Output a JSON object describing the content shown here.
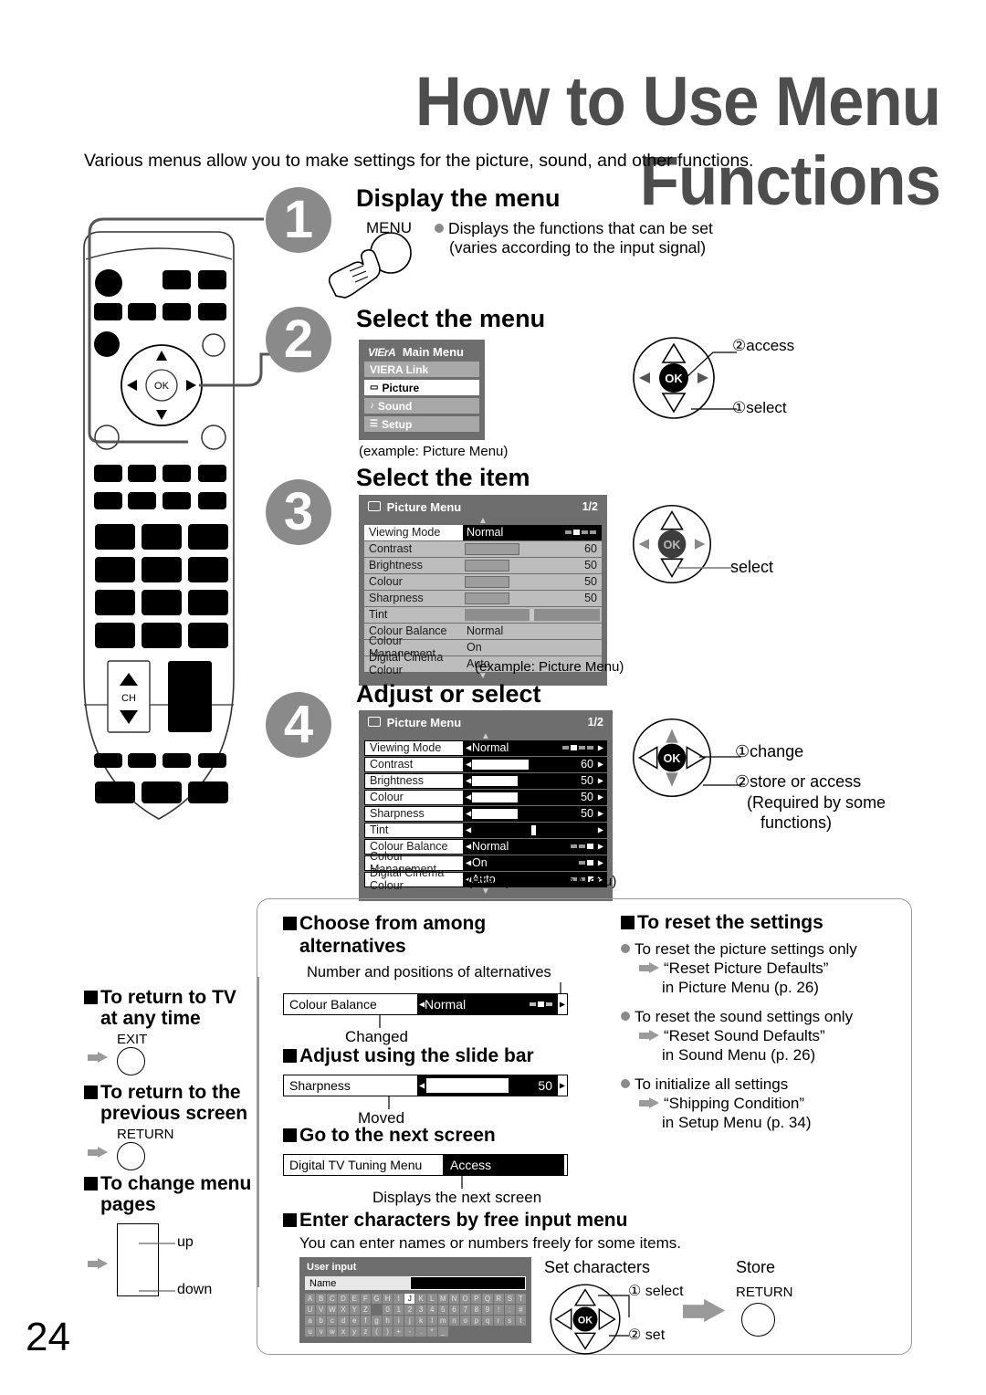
{
  "page": {
    "title": "How to Use Menu Functions",
    "intro": "Various menus allow you to make settings for the picture, sound, and other functions.",
    "number": "24"
  },
  "steps": [
    {
      "num": "1",
      "title": "Display the menu",
      "button_label": "MENU",
      "note_line1": "Displays the functions that can be set",
      "note_line2": "(varies according to the input signal)"
    },
    {
      "num": "2",
      "title": "Select the menu",
      "caption": "(example: Picture Menu)",
      "dpad": {
        "label1": "②access",
        "label2": "①select",
        "ok": "OK"
      }
    },
    {
      "num": "3",
      "title": "Select the item",
      "caption": "(example: Picture Menu)",
      "dpad": {
        "label1": "select",
        "ok": "OK"
      }
    },
    {
      "num": "4",
      "title": "Adjust or select",
      "caption": "(example: Picture Menu)",
      "dpad": {
        "ok": "OK",
        "label1": "①change",
        "label2": "②store or access",
        "label2b": "(Required by some",
        "label2c": "functions)"
      }
    }
  ],
  "main_menu": {
    "brand": "VIErA",
    "title": "Main Menu",
    "items": [
      {
        "icon": "",
        "label": "VIERA Link",
        "selected": false
      },
      {
        "icon": "picture-icon",
        "label": "Picture",
        "selected": true
      },
      {
        "icon": "sound-icon",
        "label": "Sound",
        "selected": false
      },
      {
        "icon": "setup-icon",
        "label": "Setup",
        "selected": false
      }
    ]
  },
  "picture_menu": {
    "title": "Picture Menu",
    "page": "1/2",
    "rows": [
      {
        "label": "Viewing Mode",
        "value": "Normal",
        "type": "choice",
        "dots": 4,
        "dot_on": 1,
        "selected": true
      },
      {
        "label": "Contrast",
        "value": "60",
        "type": "slider",
        "fill": 62,
        "selected": false
      },
      {
        "label": "Brightness",
        "value": "50",
        "type": "slider",
        "fill": 50,
        "selected": false
      },
      {
        "label": "Colour",
        "value": "50",
        "type": "slider",
        "fill": 50,
        "selected": false
      },
      {
        "label": "Sharpness",
        "value": "50",
        "type": "slider",
        "fill": 50,
        "selected": false
      },
      {
        "label": "Tint",
        "value": "",
        "type": "tint",
        "fill": 50,
        "selected": false
      },
      {
        "label": "Colour Balance",
        "value": "Normal",
        "type": "choice",
        "dots": 3,
        "dot_on": 2,
        "selected": false
      },
      {
        "label": "Colour Management",
        "value": "On",
        "type": "choice",
        "dots": 2,
        "dot_on": 1,
        "selected": false
      },
      {
        "label": "Digital Cinema Colour",
        "value": "Auto",
        "type": "choice",
        "dots": 3,
        "dot_on": 2,
        "selected": false
      }
    ]
  },
  "sidebar": {
    "item1": {
      "title_l1": "To return to TV",
      "title_l2": "at any time",
      "button": "EXIT"
    },
    "item2": {
      "title_l1": "To return to the",
      "title_l2": "previous screen",
      "button": "RETURN"
    },
    "item3": {
      "title_l1": "To change menu",
      "title_l2": "pages",
      "up": "up",
      "down": "down"
    }
  },
  "tips": {
    "alternatives": {
      "heading_l1": "Choose from among",
      "heading_l2": "alternatives",
      "callout_top": "Number and positions of alternatives",
      "callout_bottom": "Changed",
      "row_label": "Colour Balance",
      "row_value": "Normal"
    },
    "slidebar": {
      "heading": "Adjust using the slide bar",
      "row_label": "Sharpness",
      "row_value": "50",
      "callout": "Moved"
    },
    "next_screen": {
      "heading": "Go to the next screen",
      "row_label": "Digital TV Tuning Menu",
      "row_value": "Access",
      "callout": "Displays the next screen"
    },
    "free_input": {
      "heading": "Enter characters by free input menu",
      "subtext": "You can enter names or numbers freely for some items.",
      "panel_title": "User input",
      "field_label": "Name",
      "set_characters": "Set characters",
      "store": "Store",
      "select": "① select",
      "set": "② set",
      "return_button": "RETURN",
      "ok": "OK",
      "keys_row1": [
        "A",
        "B",
        "C",
        "D",
        "E",
        "F",
        "G",
        "H",
        "I",
        "J",
        "K",
        "L",
        "M",
        "N",
        "O",
        "P",
        "Q",
        "R",
        "S",
        "T"
      ],
      "keys_row2": [
        "U",
        "V",
        "W",
        "X",
        "Y",
        "Z",
        "",
        "0",
        "1",
        "2",
        "3",
        "4",
        "5",
        "6",
        "7",
        "8",
        "9",
        "!",
        ":",
        "#"
      ],
      "keys_row3": [
        "a",
        "b",
        "c",
        "d",
        "e",
        "f",
        "g",
        "h",
        "i",
        "j",
        "k",
        "l",
        "m",
        "n",
        "o",
        "p",
        "q",
        "r",
        "s",
        "t"
      ],
      "keys_row4": [
        "u",
        "v",
        "w",
        "x",
        "y",
        "z",
        "(",
        ")",
        "+",
        "-",
        ".",
        "*",
        "_",
        "",
        "",
        "",
        "",
        "",
        "",
        ""
      ],
      "highlight_key": "J"
    },
    "reset": {
      "heading": "To reset the settings",
      "items": [
        {
          "bullet": "To reset the picture settings only",
          "arrow_l1": "“Reset Picture Defaults”",
          "arrow_l2": "in Picture Menu (p. 26)"
        },
        {
          "bullet": "To reset the sound settings only",
          "arrow_l1": "“Reset Sound Defaults”",
          "arrow_l2": "in Sound Menu (p. 26)"
        },
        {
          "bullet": "To initialize all settings",
          "arrow_l1": "“Shipping Condition”",
          "arrow_l2": "in Setup Menu (p. 34)"
        }
      ]
    }
  },
  "colors": {
    "title_gray": "#4d4d4d",
    "step_circle": "#8a8a8a",
    "osd_bg": "#6e6e6e",
    "osd_row": "#bdbdbd",
    "frame": "#9a9a9a"
  }
}
